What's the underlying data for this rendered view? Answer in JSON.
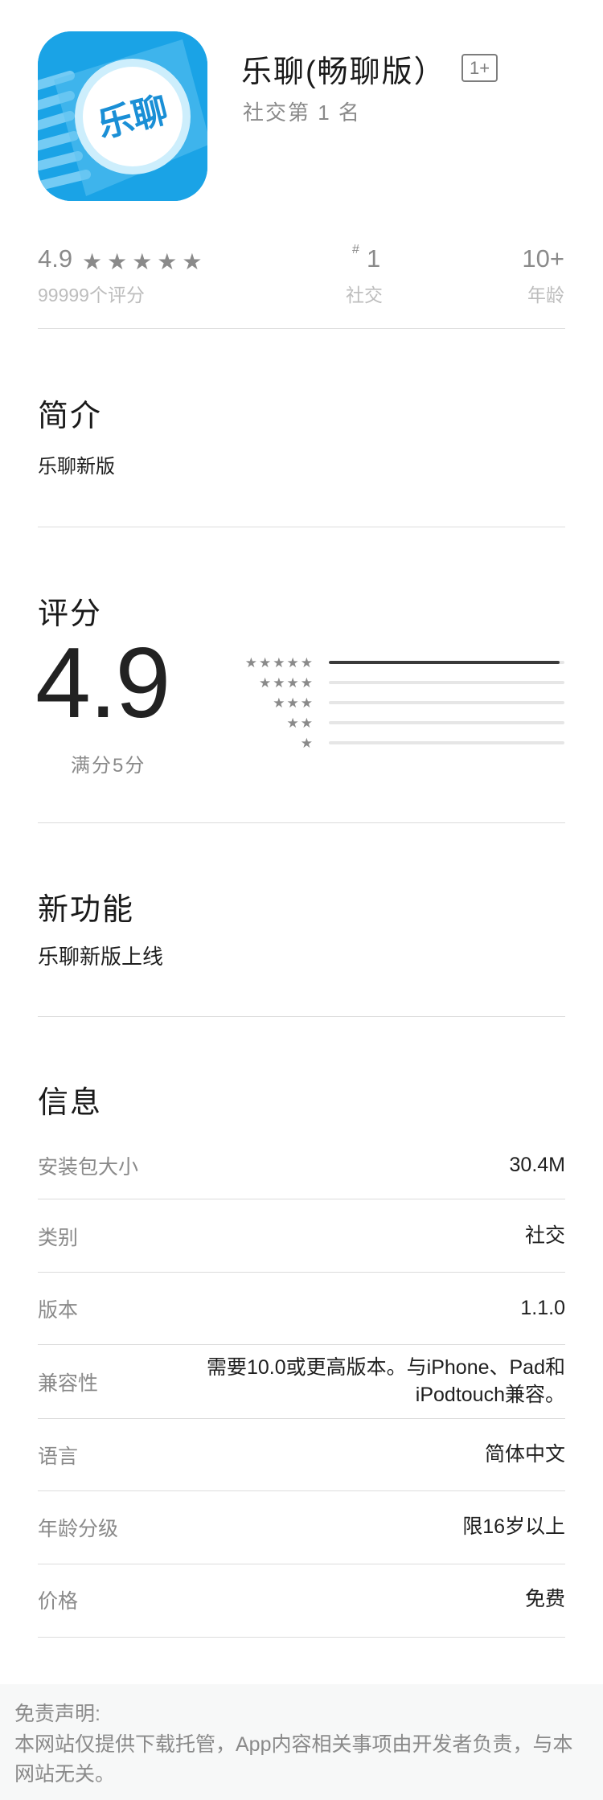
{
  "app": {
    "name": "乐聊(畅聊版）",
    "age_badge": "1+",
    "rank_text": "社交第 1 名",
    "icon_text": "乐聊",
    "icon_color": "#1aa3e6"
  },
  "stats": {
    "rating": "4.9",
    "stars": "★★★★★",
    "rating_count": "99999个评分",
    "rank_hash": "#",
    "rank": "1",
    "rank_label": "社交",
    "age": "10+",
    "age_label": "年龄"
  },
  "intro": {
    "title": "简介",
    "body": "乐聊新版"
  },
  "ratings": {
    "title": "评分",
    "score": "4.9",
    "caption": "满分5分",
    "bars": [
      {
        "stars": "★★★★★",
        "fraction": 0.98
      },
      {
        "stars": "★★★★",
        "fraction": 0.0
      },
      {
        "stars": "★★★",
        "fraction": 0.0
      },
      {
        "stars": "★★",
        "fraction": 0.0
      },
      {
        "stars": "★",
        "fraction": 0.0
      }
    ]
  },
  "whats_new": {
    "title": "新功能",
    "body": "乐聊新版上线"
  },
  "info": {
    "title": "信息",
    "rows": [
      {
        "label": "安装包大小",
        "value": "30.4M"
      },
      {
        "label": "类别",
        "value": "社交"
      },
      {
        "label": "版本",
        "value": "1.1.0"
      },
      {
        "label": "兼容性",
        "value": "需要10.0或更高版本。与iPhone、Pad和",
        "value2": "iPodtouch兼容。"
      },
      {
        "label": "语言",
        "value": "简体中文"
      },
      {
        "label": "年龄分级",
        "value": "限16岁以上"
      },
      {
        "label": "价格",
        "value": "免费"
      }
    ]
  },
  "disclaimer": {
    "title": "免责声明:",
    "body": "本网站仅提供下载托管，App内容相关事项由开发者负责，与本网站无关。"
  }
}
